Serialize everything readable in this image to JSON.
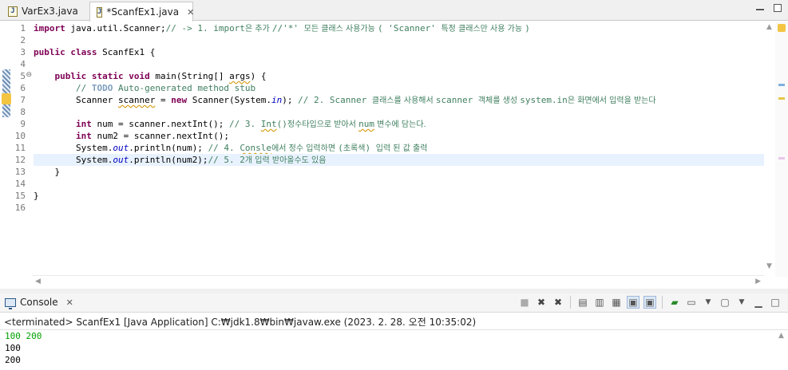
{
  "tabs": [
    {
      "label": "VarEx3.java",
      "active": false
    },
    {
      "label": "*ScanfEx1.java",
      "active": true
    }
  ],
  "icons": {
    "java_file": "java-file-icon",
    "close": "close-icon",
    "minimize": "minimize-icon",
    "maximize": "maximize-icon",
    "console": "console-icon"
  },
  "editor": {
    "current_line": 12,
    "lines": [
      {
        "n": "1",
        "fold": "",
        "html": "<span class=\"kw\">import</span> java.util.Scanner;<span class=\"cm\">// -> 1. import</span><span class=\"cmk\">은 추가 </span><span class=\"cm\">//'*' </span><span class=\"cmk\">모든 클래스 사용가능 </span><span class=\"cm\">( 'Scanner' </span><span class=\"cmk\">특정 클래스만 사용 가능 </span><span class=\"cm\">)</span>"
      },
      {
        "n": "2",
        "fold": "",
        "html": ""
      },
      {
        "n": "3",
        "fold": "",
        "html": "<span class=\"kw\">public</span> <span class=\"kw\">class</span> ScanfEx1 {"
      },
      {
        "n": "4",
        "fold": "",
        "html": ""
      },
      {
        "n": "5",
        "fold": "⊖",
        "html": "    <span class=\"kw\">public</span> <span class=\"kw\">static</span> <span class=\"kw\">void</span> main(String[] <span class=\"sq\">args</span>) {"
      },
      {
        "n": "6",
        "fold": "",
        "html": "        <span class=\"cm\">// </span><span class=\"todo\">TODO</span><span class=\"cm\"> Auto-generated method stub</span>"
      },
      {
        "n": "7",
        "fold": "",
        "html": "        Scanner <span class=\"sq\">scanner</span> = <span class=\"kw\">new</span> Scanner(System.<span class=\"fld\">in</span>); <span class=\"cm\">// 2. Scanner </span><span class=\"cmk\">클래스를 사용해서 </span><span class=\"cm\">scanner </span><span class=\"cmk\">객체를 생성 </span><span class=\"cm\">system.in</span><span class=\"cmk\">은 화면에서 입력을 받는다</span>"
      },
      {
        "n": "8",
        "fold": "",
        "html": ""
      },
      {
        "n": "9",
        "fold": "",
        "html": "        <span class=\"kw\">int</span> num = scanner.nextInt(); <span class=\"cm\">// 3. </span><span class=\"cm sq\">Int</span><span class=\"cm\">()</span><span class=\"cmk\">정수타입으로 받아서 </span><span class=\"cm sq\">num</span><span class=\"cmk\"> 변수에 담는다.</span>"
      },
      {
        "n": "10",
        "fold": "",
        "html": "        <span class=\"kw\">int</span> num2 = scanner.nextInt();"
      },
      {
        "n": "11",
        "fold": "",
        "html": "        System.<span class=\"fld\">out</span>.println(num); <span class=\"cm\">// 4. </span><span class=\"cm sq\">Consle</span><span class=\"cmk\">에서 정수 입력하면 </span><span class=\"cm\">(</span><span class=\"cmk\">초록색</span><span class=\"cm\">) </span><span class=\"cmk\">입력 된 값 출력</span>"
      },
      {
        "n": "12",
        "fold": "",
        "html": "        System.<span class=\"fld\">out</span>.println(num2);<span class=\"cm\">// 5. 2</span><span class=\"cmk\">개 입력 받아올수도 있음</span>"
      },
      {
        "n": "13",
        "fold": "",
        "html": "    }"
      },
      {
        "n": "14",
        "fold": "",
        "html": ""
      },
      {
        "n": "15",
        "fold": "",
        "html": "}"
      },
      {
        "n": "16",
        "fold": "",
        "html": ""
      }
    ]
  },
  "console": {
    "title": "Console",
    "status": "<terminated> ScanfEx1 [Java Application] C:₩jdk1.8₩bin₩javaw.exe (2023. 2. 28. 오전 10:35:02)",
    "output": [
      {
        "text": "100 200",
        "kind": "in"
      },
      {
        "text": "100",
        "kind": "out"
      },
      {
        "text": "200",
        "kind": "out"
      }
    ]
  }
}
